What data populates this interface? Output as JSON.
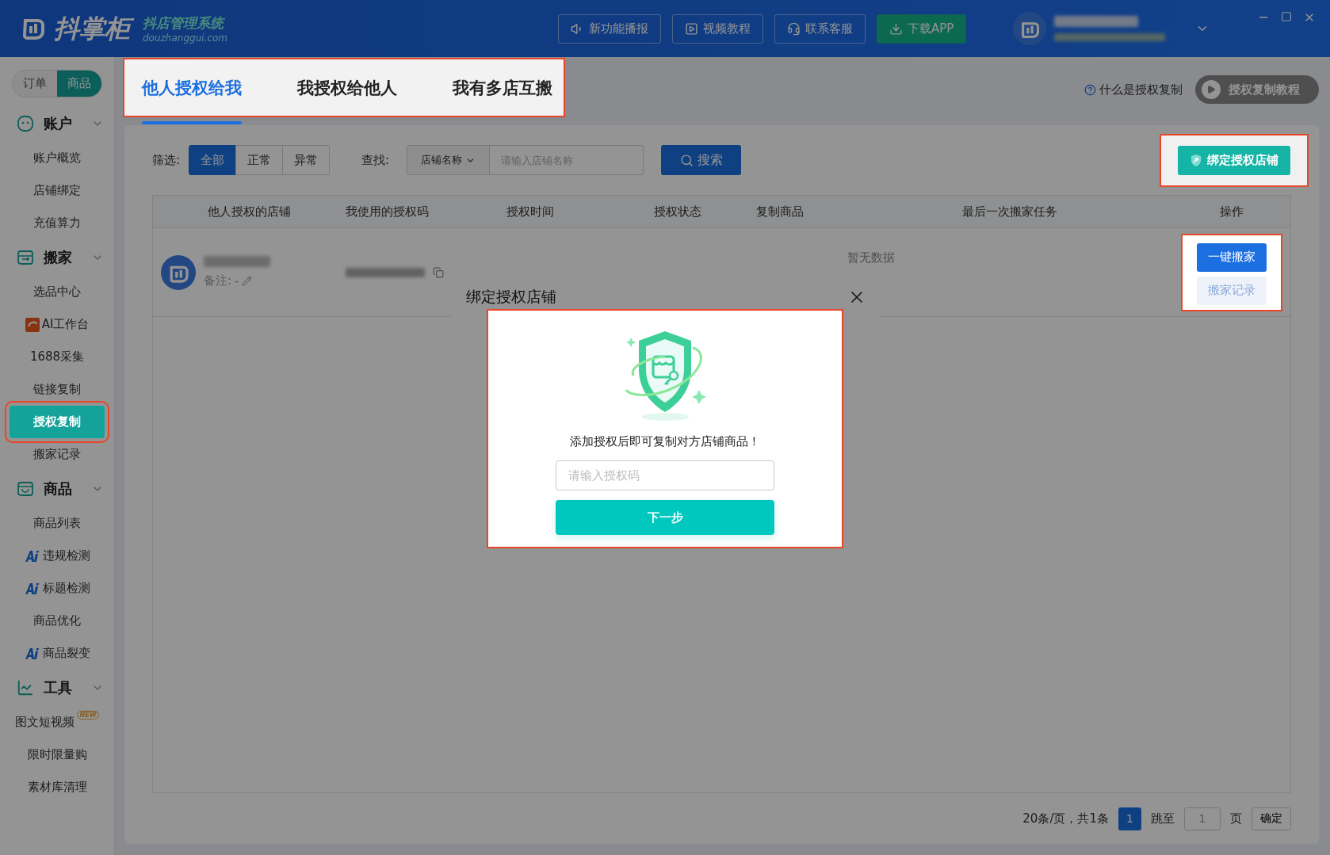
{
  "header": {
    "logo_title": "抖掌柜",
    "logo_subtitle": "抖店管理系统",
    "logo_domain": "douzhanggui.com",
    "buttons": [
      {
        "label": "新功能播报",
        "kind": "speaker"
      },
      {
        "label": "视频教程",
        "kind": "video"
      },
      {
        "label": "联系客服",
        "kind": "headset"
      },
      {
        "label": "下载APP",
        "kind": "download"
      }
    ]
  },
  "sidebar": {
    "toggle": [
      {
        "label": "订单",
        "selected": false
      },
      {
        "label": "商品",
        "selected": true
      }
    ],
    "groups": [
      {
        "title": "账户",
        "kind": "account",
        "expanded": true,
        "items": [
          {
            "label": "账户概览",
            "selected": false
          },
          {
            "label": "店铺绑定",
            "selected": false
          },
          {
            "label": "充值算力",
            "selected": false
          }
        ]
      },
      {
        "title": "搬家",
        "kind": "move",
        "expanded": true,
        "items": [
          {
            "label": "选品中心",
            "selected": false
          },
          {
            "label": "AI工作台",
            "selected": false,
            "kind": "app"
          },
          {
            "label": "1688采集",
            "selected": false
          },
          {
            "label": "链接复制",
            "selected": false
          },
          {
            "label": "授权复制",
            "selected": true,
            "highlighted": true
          },
          {
            "label": "搬家记录",
            "selected": false
          }
        ]
      },
      {
        "title": "商品",
        "kind": "goods",
        "expanded": true,
        "items": [
          {
            "label": "商品列表",
            "selected": false
          },
          {
            "label": "违规检测",
            "selected": false,
            "kind": "ai"
          },
          {
            "label": "标题检测",
            "selected": false,
            "kind": "ai"
          },
          {
            "label": "商品优化",
            "selected": false
          },
          {
            "label": "商品裂变",
            "selected": false,
            "kind": "ai"
          }
        ]
      },
      {
        "title": "工具",
        "kind": "tools",
        "expanded": true,
        "items": [
          {
            "label": "图文短视频",
            "selected": false,
            "badge": "NEW"
          },
          {
            "label": "限时限量购",
            "selected": false
          },
          {
            "label": "素材库清理",
            "selected": false
          }
        ]
      }
    ]
  },
  "tabs": {
    "highlighted": true,
    "items": [
      {
        "label": "他人授权给我",
        "selected": true
      },
      {
        "label": "我授权给他人",
        "selected": false
      },
      {
        "label": "我有多店互搬",
        "selected": false
      }
    ]
  },
  "help_link": "什么是授权复制",
  "tutorial_button": "授权复制教程",
  "filter": {
    "label": "筛选:",
    "options": [
      {
        "label": "全部",
        "selected": true
      },
      {
        "label": "正常",
        "selected": false
      },
      {
        "label": "异常",
        "selected": false
      }
    ],
    "find_label": "查找:",
    "find_select": "店铺名称",
    "find_placeholder": "请输入店铺名称",
    "search_button": "搜索",
    "bind_button": "绑定授权店铺",
    "bind_highlighted": true
  },
  "table": {
    "columns": [
      "他人授权的店铺",
      "我使用的授权码",
      "授权时间",
      "授权状态",
      "复制商品",
      "最后一次搬家任务",
      "操作"
    ],
    "rows": [
      {
        "note_label": "备注:",
        "note_value": "-",
        "last_task": "暂无数据",
        "actions_highlighted": true,
        "actions": [
          {
            "label": "一键搬家",
            "kind": "primary"
          },
          {
            "label": "搬家记录",
            "kind": "light"
          }
        ]
      }
    ]
  },
  "pagination": {
    "summary": "20条/页，共1条",
    "pages": [
      {
        "label": "1",
        "selected": true
      }
    ],
    "jump_label": "跳至",
    "jump_value": "1",
    "page_unit": "页",
    "confirm": "确定"
  },
  "modal": {
    "title": "绑定授权店铺",
    "message": "添加授权后即可复制对方店铺商品！",
    "placeholder": "请输入授权码",
    "button": "下一步",
    "highlighted": true
  },
  "guide_overlay": true
}
